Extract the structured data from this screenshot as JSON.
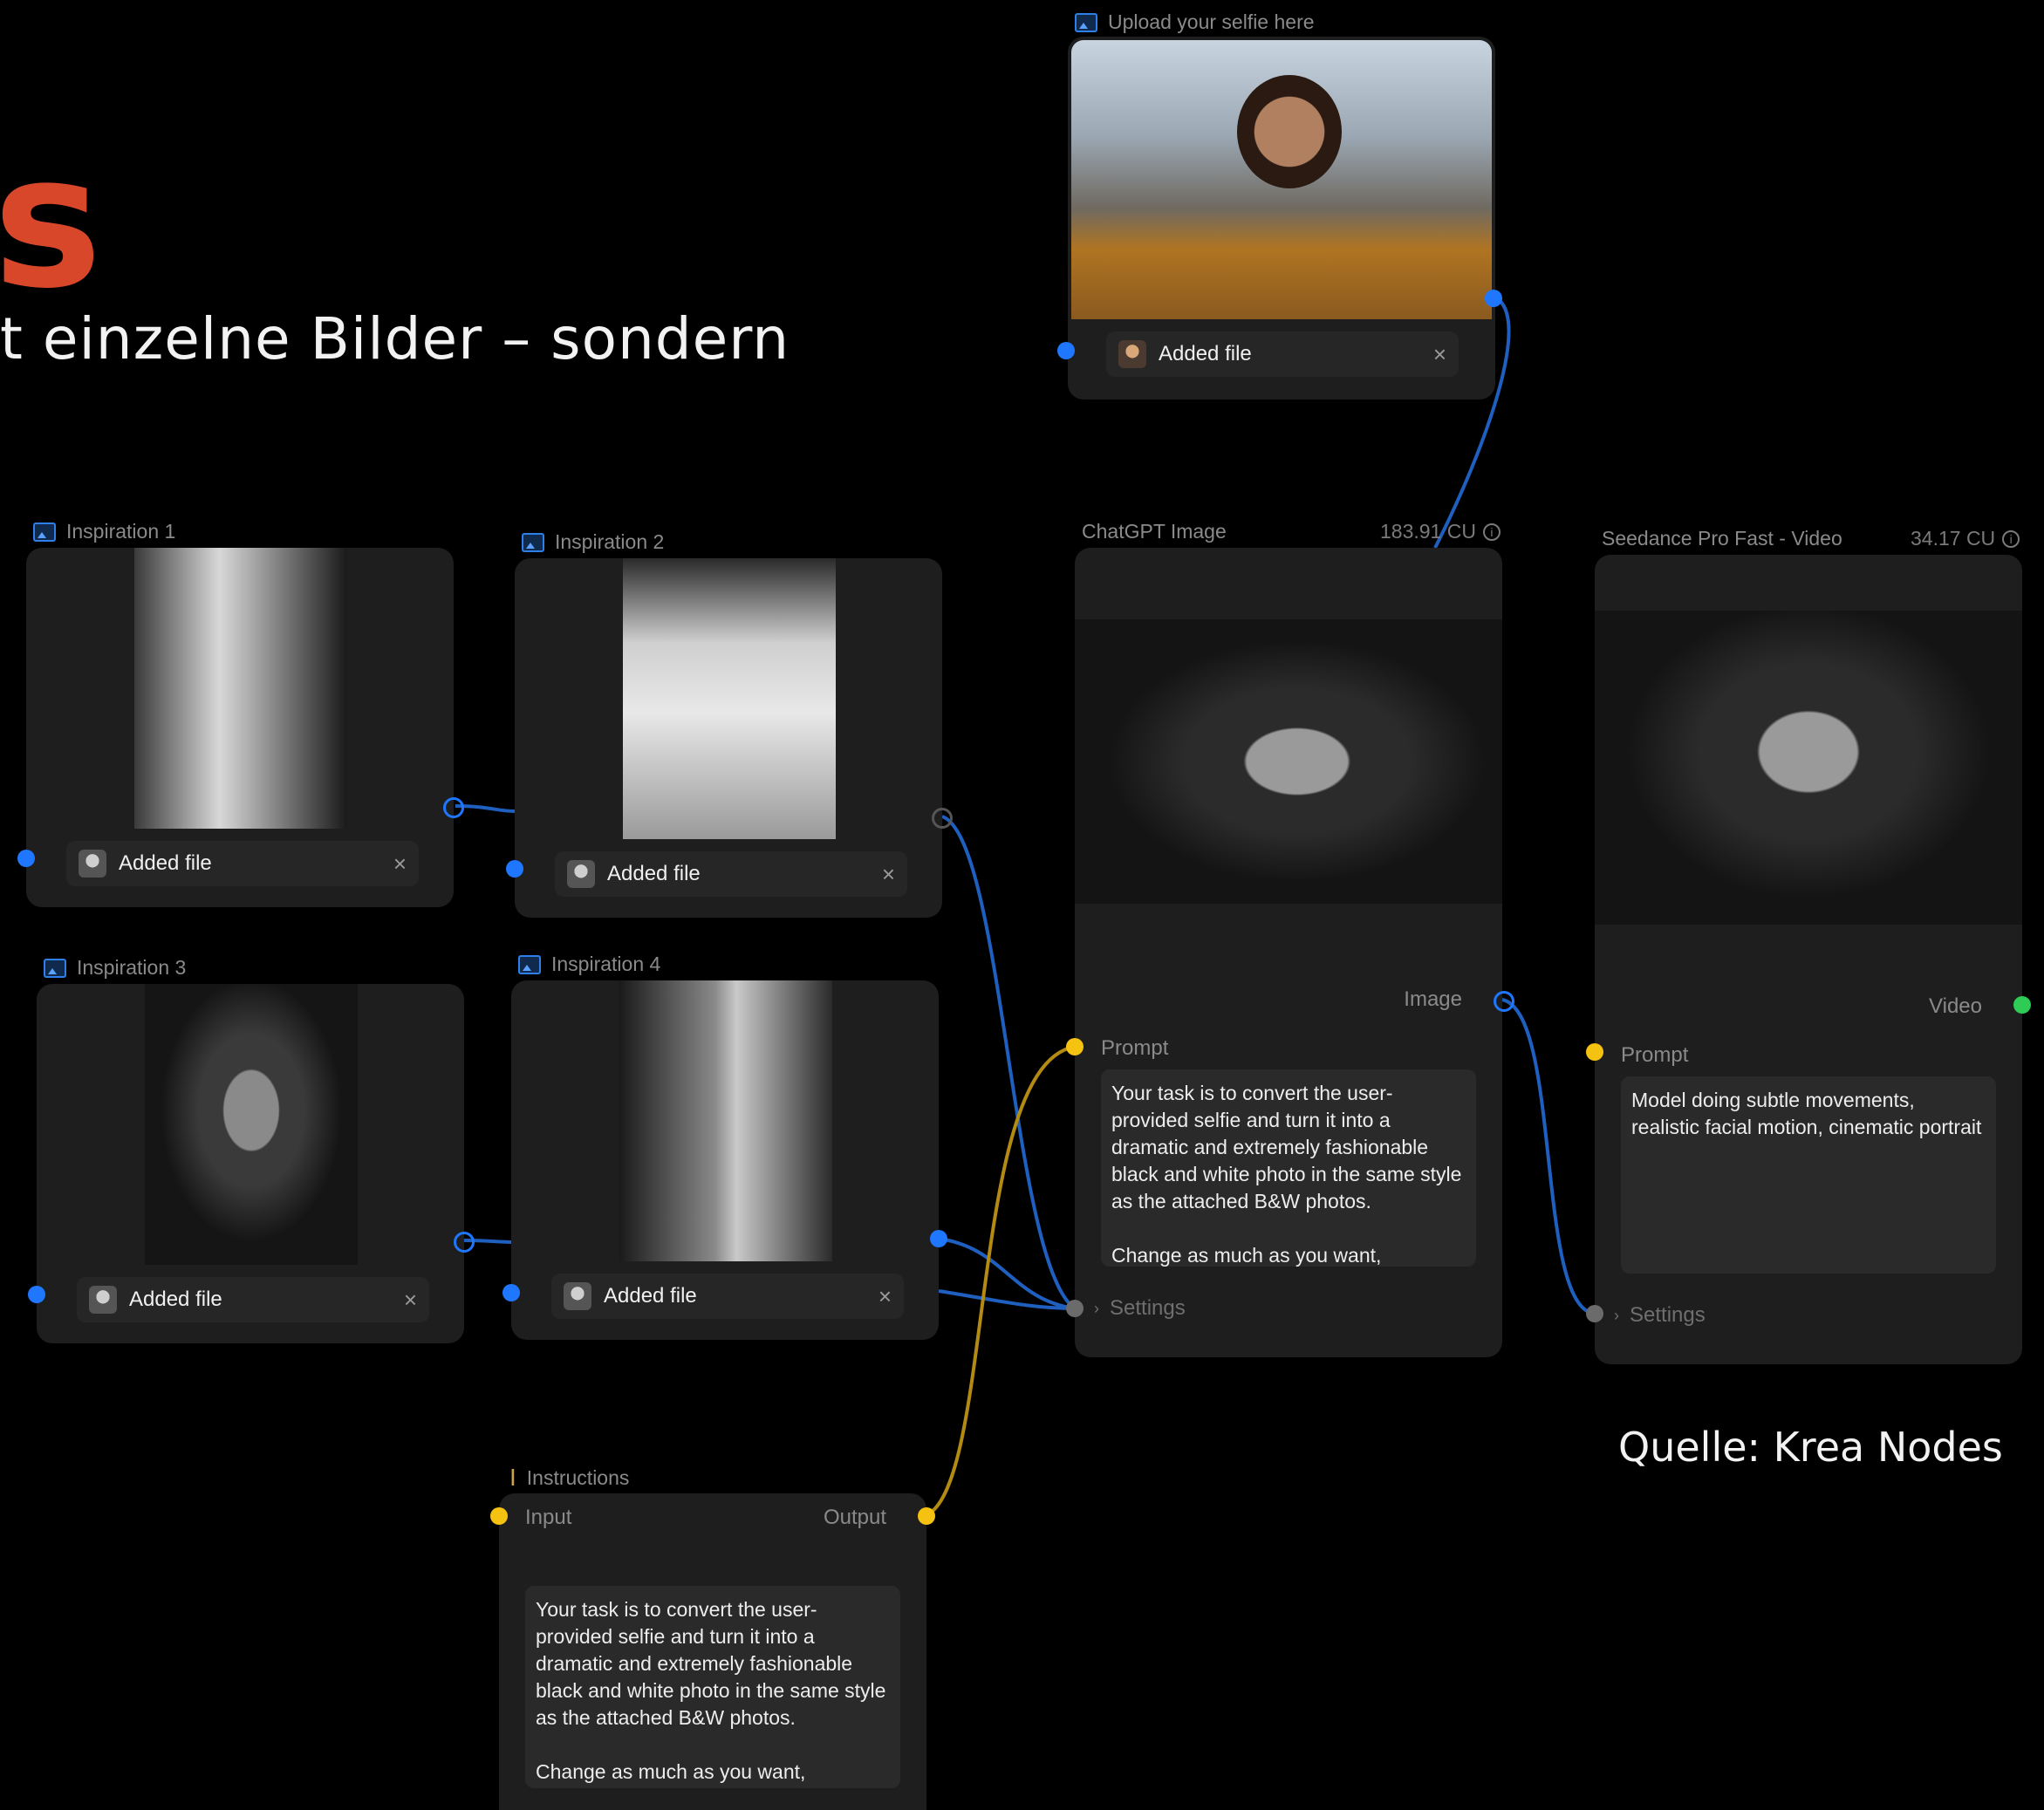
{
  "slide": {
    "heading_fragment": "s",
    "subtitle_fragment": "t einzelne Bilder – sondern",
    "source": "Quelle: Krea Nodes"
  },
  "colors": {
    "accent": "#d9472b",
    "port_image": "#1f77ff",
    "port_text": "#f5c211",
    "port_video": "#2ecc55"
  },
  "nodes": {
    "selfie": {
      "title": "Upload your selfie here",
      "file_label": "Added file",
      "icon": "image-icon"
    },
    "inspiration1": {
      "title": "Inspiration 1",
      "file_label": "Added file",
      "icon": "image-icon"
    },
    "inspiration2": {
      "title": "Inspiration 2",
      "file_label": "Added file",
      "icon": "image-icon"
    },
    "inspiration3": {
      "title": "Inspiration 3",
      "file_label": "Added file",
      "icon": "image-icon"
    },
    "inspiration4": {
      "title": "Inspiration 4",
      "file_label": "Added file",
      "icon": "image-icon"
    },
    "chatgpt": {
      "title": "ChatGPT Image",
      "cost": "183.91 CU",
      "output_label": "Image",
      "prompt_label": "Prompt",
      "prompt_text": "Your task is to convert the user-provided selfie and turn it into a dramatic and extremely fashionable black and white photo in the same style as the attached B&W photos.\n\nChange as much as you want,",
      "settings_label": "Settings"
    },
    "seedance": {
      "title": "Seedance Pro Fast - Video",
      "cost": "34.17 CU",
      "output_label": "Video",
      "prompt_label": "Prompt",
      "prompt_text": "Model doing subtle movements, realistic facial motion, cinematic portrait",
      "settings_label": "Settings"
    },
    "instructions": {
      "title": "Instructions",
      "input_label": "Input",
      "output_label": "Output",
      "text": "Your task is to convert the user-provided selfie and turn it into a dramatic and extremely fashionable black and white photo in the same style as the attached B&W photos.\n\nChange as much as you want,"
    }
  }
}
